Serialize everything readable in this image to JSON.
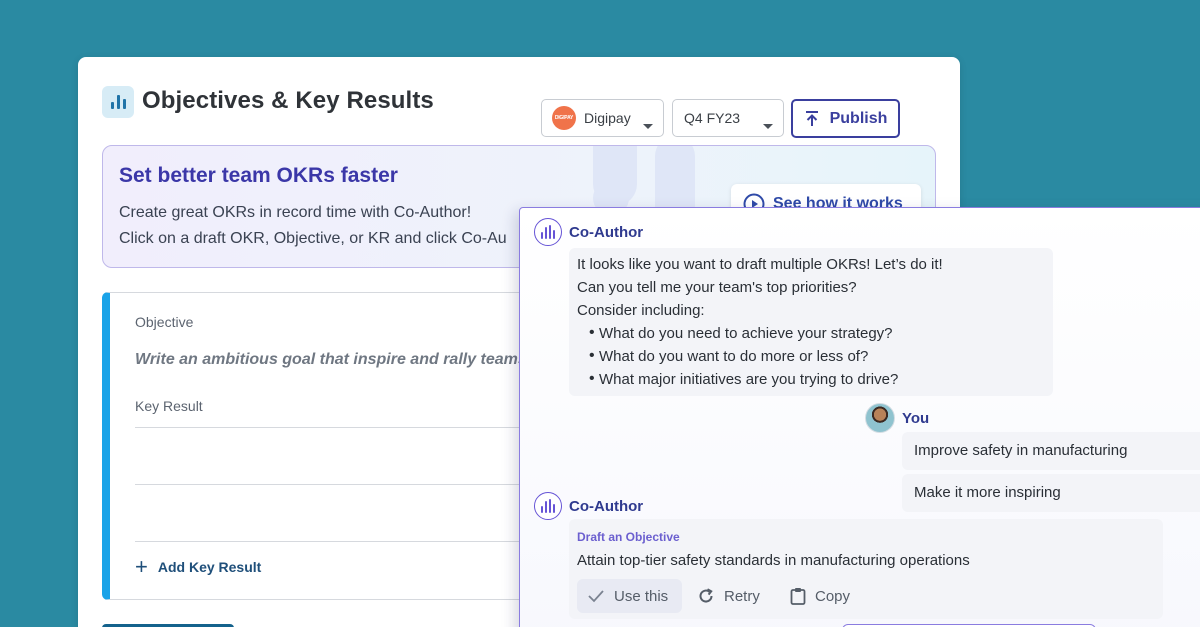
{
  "header": {
    "title": "Objectives & Key Results",
    "org": {
      "name": "Digipay",
      "logo_text": "DIGIPAY"
    },
    "quarter": "Q4 FY23",
    "publish_label": "Publish"
  },
  "banner": {
    "title": "Set better team OKRs faster",
    "line1": "Create great OKRs in record time with Co-Author!",
    "line2": "Click on a draft OKR, Objective, or KR and click Co-Au",
    "how_button_label": "See how it works"
  },
  "okr_form": {
    "objective_label": "Objective",
    "objective_placeholder": "Write an ambitious goal that inspire and rally teams tow",
    "key_result_label": "Key Result",
    "add_key_result_label": "Add Key Result"
  },
  "chat": {
    "messages": [
      {
        "sender": "Co-Author",
        "lines": [
          "It looks like you want to draft multiple OKRs! Let’s do it!",
          "Can you tell me your team's top priorities?",
          "Consider including:"
        ],
        "bullets": [
          "What do you need to achieve your strategy?",
          "What do you want to do more or less of?",
          "What major initiatives are you trying to drive?"
        ]
      },
      {
        "sender": "You",
        "replies": [
          "Improve safety in manufacturing",
          "Make it more inspiring"
        ]
      },
      {
        "sender": "Co-Author",
        "draft_label": "Draft an Objective",
        "draft_text": "Attain top-tier safety standards in manufacturing operations",
        "actions": [
          "Use this",
          "Retry",
          "Copy"
        ]
      }
    ]
  },
  "colors": {
    "background": "#2a8aa2",
    "accent_purple": "#3b37a8",
    "okr_border": "#1aa3e8",
    "publish": "#3a3f9e"
  },
  "icons": {
    "app": "bar-chart-icon",
    "publish": "upload-icon",
    "how": "play-circle-icon",
    "coauthor": "coauthor-logo-icon",
    "add": "plus-icon",
    "use": "check-icon",
    "retry": "retry-icon",
    "copy": "clipboard-icon"
  }
}
